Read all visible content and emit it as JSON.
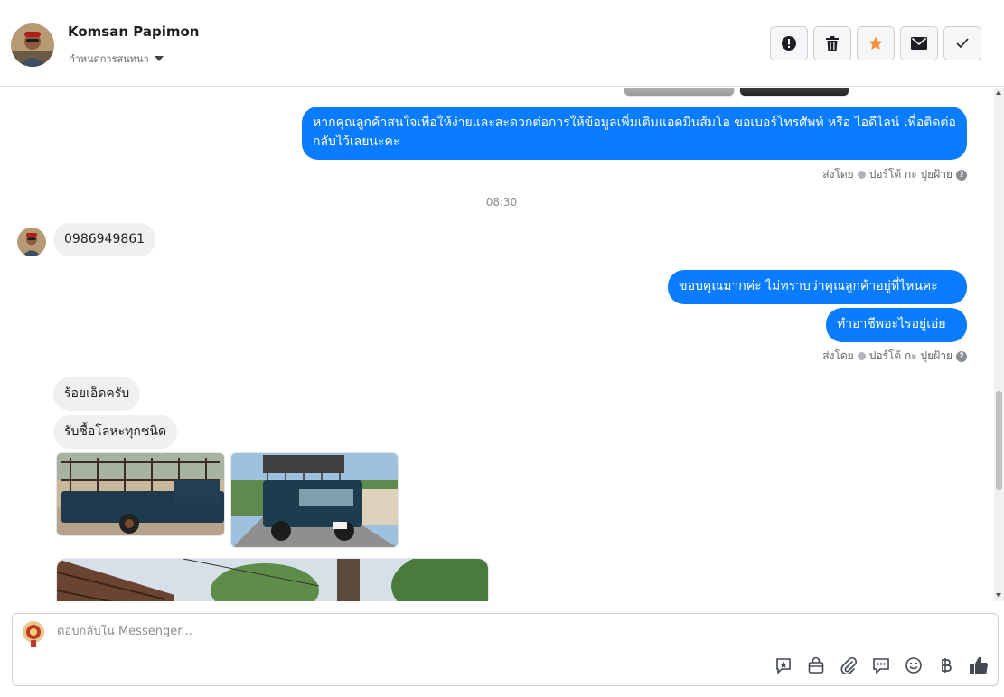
{
  "header": {
    "contact_name": "Komsan Papimon",
    "subtitle": "กำหนดการสนทนา",
    "actions": [
      {
        "name": "report",
        "icon": "exclamation-circle-icon"
      },
      {
        "name": "delete",
        "icon": "trash-icon"
      },
      {
        "name": "star",
        "icon": "star-icon",
        "color": "#f7923b"
      },
      {
        "name": "mark-unread",
        "icon": "envelope-icon"
      },
      {
        "name": "mark-done",
        "icon": "check-icon"
      }
    ]
  },
  "conversation": {
    "outgoing_1": "หากคุณลูกค้าสนใจเพื่อให้ง่ายและสะดวกต่อการให้ข้อมูลเพิ่มเติมแอดมินส้มโอ ขอเบอร์โทรศัพท์ หรือ ไอดีไลน์ เพื่อติดต่อกลับไว้เลยนะคะ",
    "sent_by_1_prefix": "ส่งโดย",
    "sent_by_1_name": "ปอร์โต้ กะ ปุยฝ้าย",
    "timestamp": "08:30",
    "incoming_phone": "0986949861",
    "outgoing_2": "ขอบคุณมากค่ะ ไม่ทราบว่าคุณลูกค้าอยู่ที่ไหนคะ",
    "outgoing_3": "ทำอาชีพอะไรอยู่เอ่ย",
    "sent_by_2_prefix": "ส่งโดย",
    "sent_by_2_name": "ปอร์โต้ กะ ปุยฝ้าย",
    "incoming_2": "ร้อยเอ็ดครับ",
    "incoming_3": "รับซื้อโลหะทุกชนิด"
  },
  "composer": {
    "placeholder": "ตอบกลับใน Messenger...",
    "tools": [
      "saved-reply-icon",
      "shopping-bag-icon",
      "paperclip-icon",
      "chat-bubbles-icon",
      "emoji-icon",
      "baht-icon",
      "thumbs-up-icon"
    ]
  },
  "colors": {
    "outgoing_bubble": "#0a7cff",
    "incoming_bubble": "#f0f0f0",
    "star": "#f7923b"
  }
}
